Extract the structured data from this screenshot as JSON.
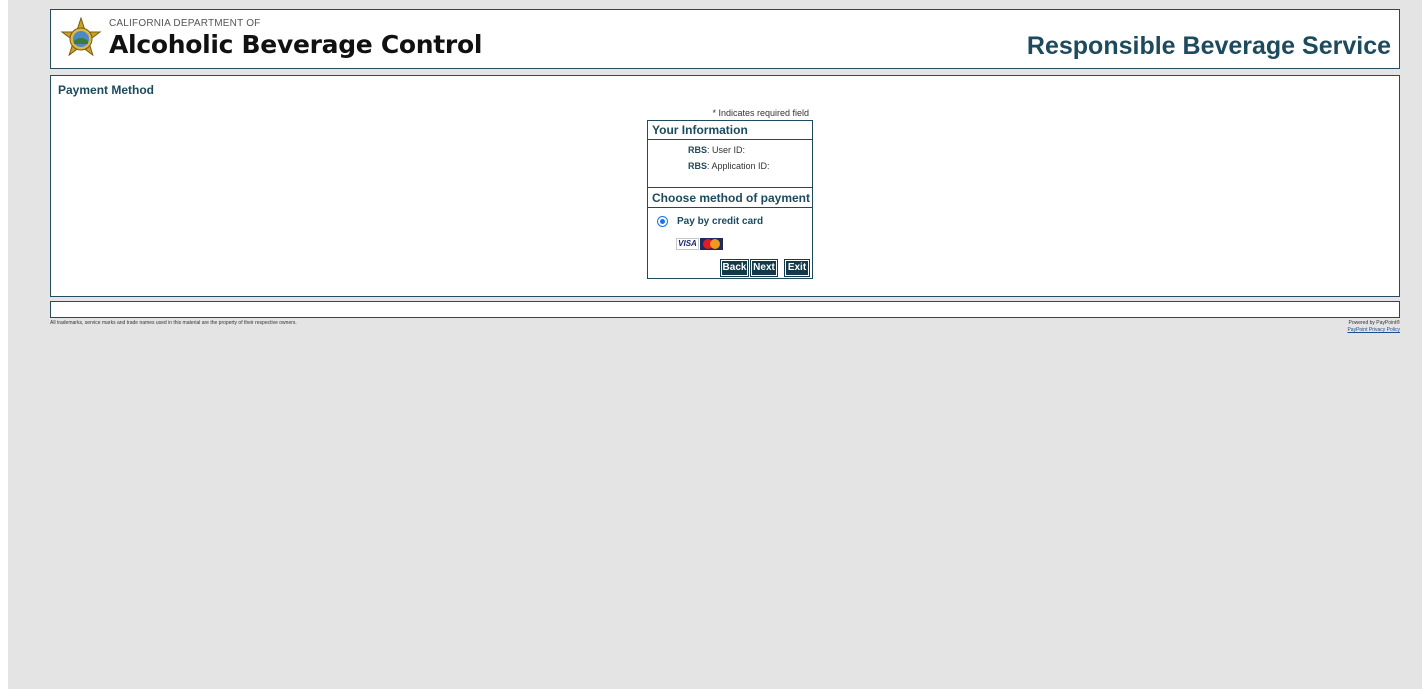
{
  "header": {
    "dept_small": "CALIFORNIA DEPARTMENT OF",
    "dept_big": "Alcoholic Beverage Control",
    "site_title": "Responsible Beverage Service"
  },
  "main": {
    "page_title": "Payment Method",
    "required_note": "* Indicates required field",
    "your_info": {
      "heading": "Your Information",
      "rows": [
        {
          "prefix": "RBS",
          "label": ": User ID:"
        },
        {
          "prefix": "RBS",
          "label": ": Application ID:"
        }
      ]
    },
    "payment": {
      "heading": "Choose method of payment",
      "option_label": "Pay by credit card",
      "option_selected": true,
      "card_icons": [
        "visa-icon",
        "mastercard-icon"
      ],
      "visa_text": "VISA"
    },
    "buttons": {
      "back": "Back",
      "next": "Next",
      "exit": "Exit"
    }
  },
  "footer": {
    "trademark": "All trademarks, service marks and trade names used in this material are the property of their respective owners.",
    "powered": "Powered by PayPoint®",
    "privacy": "PayPoint Privacy Policy"
  },
  "colors": {
    "brand_dark": "#1d4a5c",
    "button_bg": "#13394a",
    "page_bg": "#e4e4e4",
    "radio_accent": "#1a73e8"
  }
}
